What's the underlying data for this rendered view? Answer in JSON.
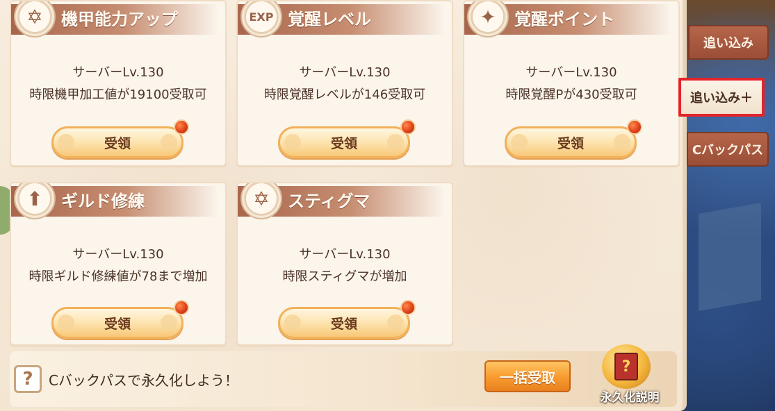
{
  "cards": [
    {
      "title": "機甲能力アップ",
      "emblem": "✡",
      "line1": "サーバーLv.130",
      "line2": "時限機甲加工値が19100受取可",
      "button": "受領"
    },
    {
      "title": "覚醒レベル",
      "emblem": "EXP",
      "line1": "サーバーLv.130",
      "line2": "時限覚醒レベルが146受取可",
      "button": "受領"
    },
    {
      "title": "覚醒ポイント",
      "emblem": "✦",
      "line1": "サーバーLv.130",
      "line2": "時限覚醒Pが430受取可",
      "button": "受領"
    },
    {
      "title": "ギルド修練",
      "emblem": "⬆",
      "line1": "サーバーLv.130",
      "line2": "時限ギルド修練値が78まで増加",
      "button": "受領"
    },
    {
      "title": "スティグマ",
      "emblem": "✡",
      "line1": "サーバーLv.130",
      "line2": "時限スティグマが増加",
      "button": "受領"
    }
  ],
  "footer": {
    "help_glyph": "?",
    "message": "Cバックパスで永久化しよう！",
    "bulk_button": "一括受取",
    "permanent_label": "永久化説明",
    "permanent_glyph": "?"
  },
  "side_tabs": {
    "chase": "追い込み",
    "chase_plus": "追い込み＋",
    "cpass": "Cバックパス"
  },
  "colors": {
    "header": "#a8654b",
    "button_border": "#f2b15a",
    "bulk_button": "#f79a2e",
    "highlight_frame": "#e3242b",
    "red_dot": "#e0421a"
  },
  "icons": {
    "help": "question-mark-icon",
    "permanent": "book-icon",
    "notification": "red-dot-icon"
  }
}
